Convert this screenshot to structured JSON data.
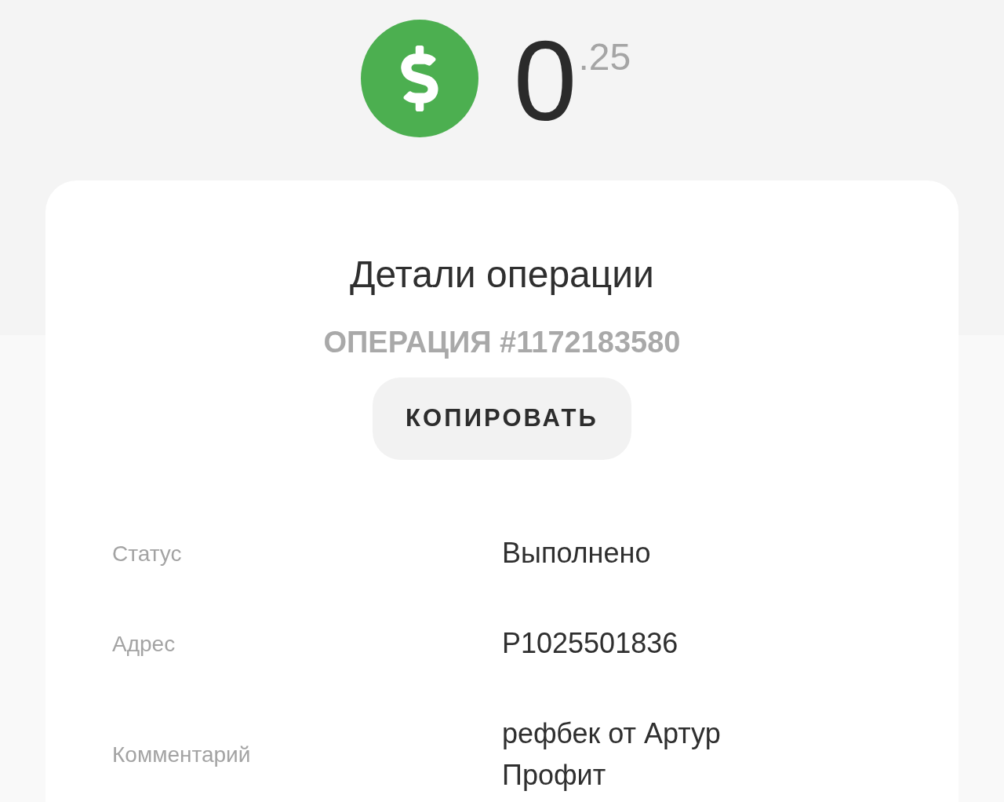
{
  "balance": {
    "whole": "0",
    "fraction": ".25"
  },
  "details": {
    "title": "Детали операции",
    "operation_number": "ОПЕРАЦИЯ #1172183580",
    "copy_button": "КОПИРОВАТЬ",
    "rows": [
      {
        "label": "Статус",
        "value": "Выполнено"
      },
      {
        "label": "Адрес",
        "value": "P1025501836"
      },
      {
        "label": "Комментарий",
        "value": "рефбек от Артур Профит"
      }
    ]
  }
}
